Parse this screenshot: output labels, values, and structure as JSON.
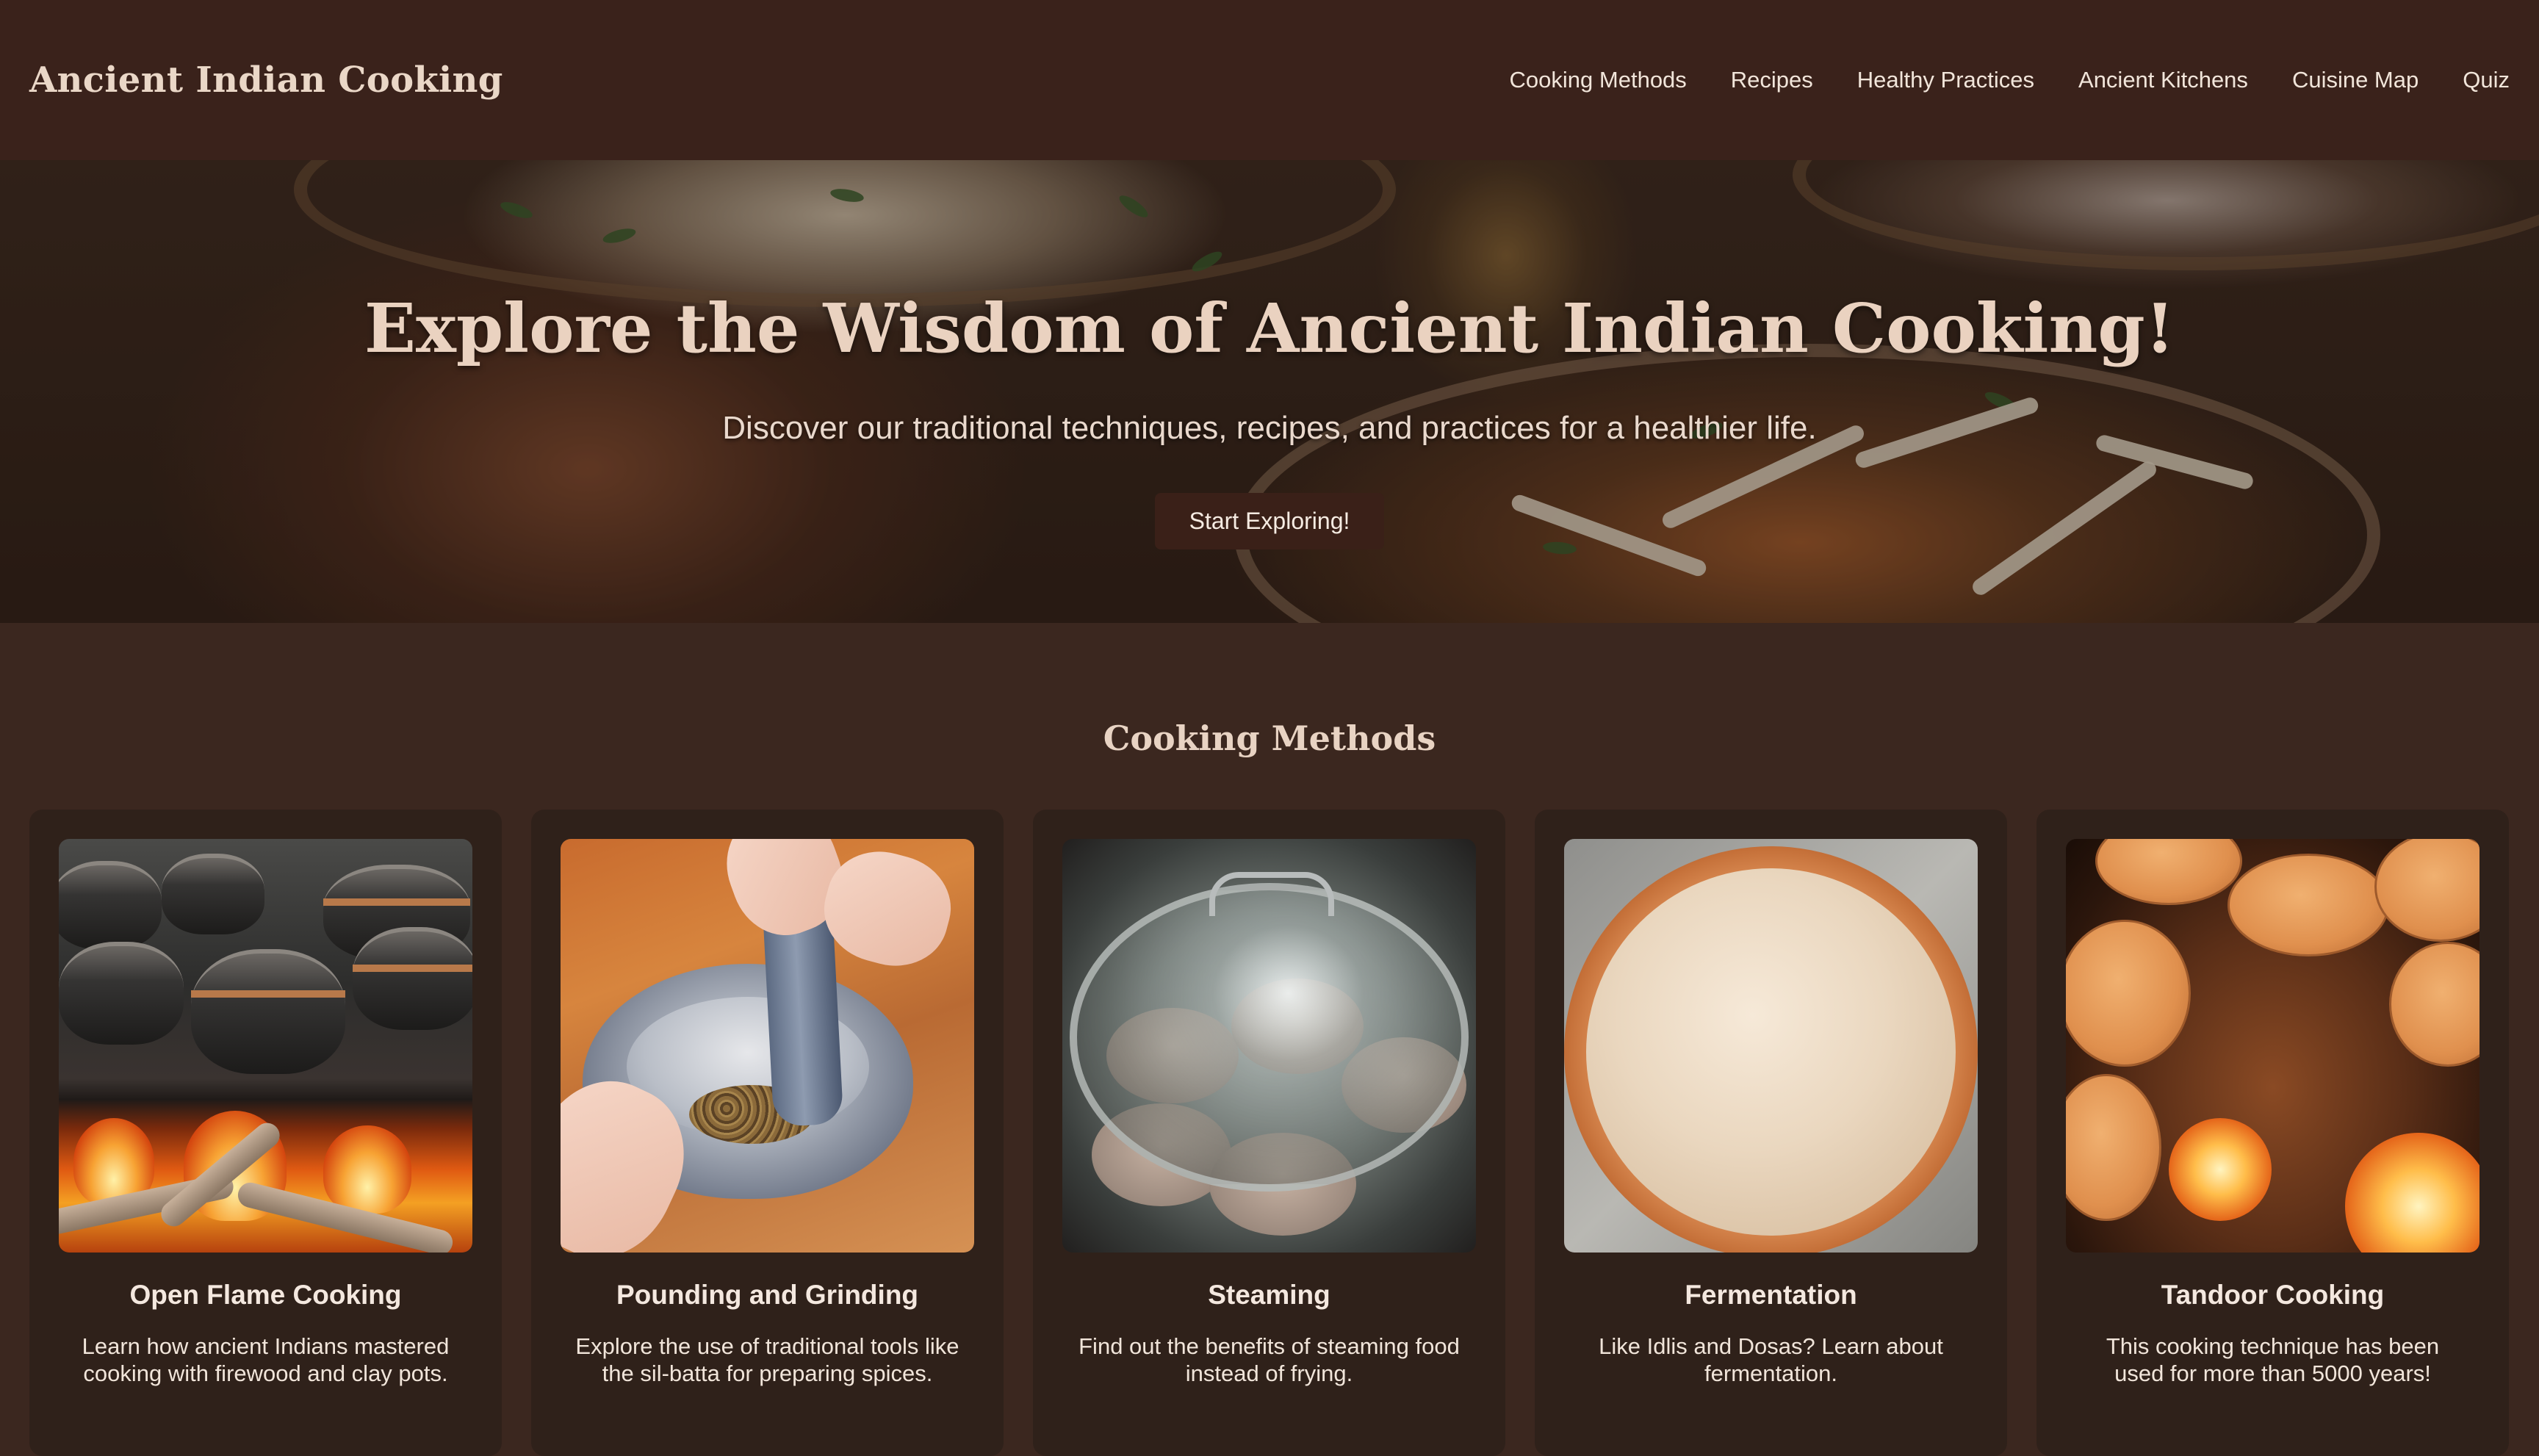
{
  "header": {
    "brand": "Ancient Indian Cooking",
    "nav": [
      "Cooking Methods",
      "Recipes",
      "Healthy Practices",
      "Ancient Kitchens",
      "Cuisine Map",
      "Quiz"
    ]
  },
  "hero": {
    "title": "Explore the Wisdom of Ancient Indian Cooking!",
    "subtitle": "Discover our traditional techniques, recipes, and practices for a healthier life.",
    "cta": "Start Exploring!"
  },
  "methods": {
    "title": "Cooking Methods",
    "cards": [
      {
        "title": "Open Flame Cooking",
        "description": "Learn how ancient Indians mastered cooking with firewood and clay pots."
      },
      {
        "title": "Pounding and Grinding",
        "description": "Explore the use of traditional tools like the sil-batta for preparing spices."
      },
      {
        "title": "Steaming",
        "description": "Find out the benefits of steaming food instead of frying."
      },
      {
        "title": "Fermentation",
        "description": "Like Idlis and Dosas? Learn about fermentation."
      },
      {
        "title": "Tandoor Cooking",
        "description": "This cooking technique has been used for more than 5000 years!"
      }
    ]
  },
  "colors": {
    "header_bg": "#3a221b",
    "page_bg": "#3b271f",
    "card_bg": "#2f211a",
    "button_bg": "#3a2018",
    "heading_text": "#ead2c0"
  }
}
